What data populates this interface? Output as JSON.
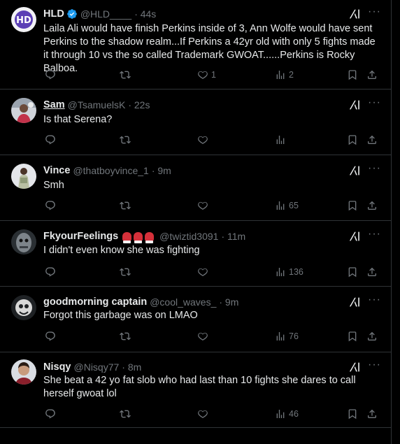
{
  "posts": [
    {
      "name": "HLD",
      "handle": "@HLD____",
      "time": "· 44s",
      "verified": true,
      "text": "Laila Ali would have finish Perkins inside of 3, Ann Wolfe would have sent Perkins to the shadow realm...If Perkins a 42yr old with only 5 fights made it through 10 vs the so called Trademark GWOAT......Perkins is Rocky Balboa.",
      "replies": "",
      "reposts": "",
      "likes": "1",
      "views": "2"
    },
    {
      "name": "Sam",
      "handle": "@TsamuelsK",
      "time": "· 22s",
      "text": "Is that Serena?",
      "replies": "",
      "reposts": "",
      "likes": "",
      "views": ""
    },
    {
      "name": "Vince",
      "handle": "@thatboyvince_1",
      "time": "· 9m",
      "text": "Smh",
      "replies": "",
      "reposts": "",
      "likes": "",
      "views": "65"
    },
    {
      "name": "FkyourFeelings",
      "handle": "@twiztid3091",
      "time": "· 11m",
      "text": "I didn't even know she was fighting",
      "replies": "",
      "reposts": "",
      "likes": "",
      "views": "136"
    },
    {
      "name": "goodmorning captain",
      "handle": "@cool_waves_",
      "time": "· 9m",
      "text": "Forgot this garbage was on LMAO",
      "replies": "",
      "reposts": "",
      "likes": "",
      "views": "76"
    },
    {
      "name": "Nisqy",
      "handle": "@Nisqy77",
      "time": "· 8m",
      "text": "She beat a 42 yo fat slob who had last than 10 fights she dares to call herself gwoat lol",
      "replies": "",
      "reposts": "",
      "likes": "",
      "views": "46"
    }
  ],
  "icons": {
    "reply": "reply-icon",
    "repost": "repost-icon",
    "like": "heart-icon",
    "views": "views-icon",
    "bookmark": "bookmark-icon",
    "share": "share-icon",
    "grok": "grok-icon",
    "more": "more-icon",
    "verified": "verified-badge-icon"
  },
  "colors": {
    "background": "#000000",
    "text": "#e7e9ea",
    "muted": "#71767b",
    "divider": "#2f3336",
    "verified": "#1d9bf0"
  }
}
